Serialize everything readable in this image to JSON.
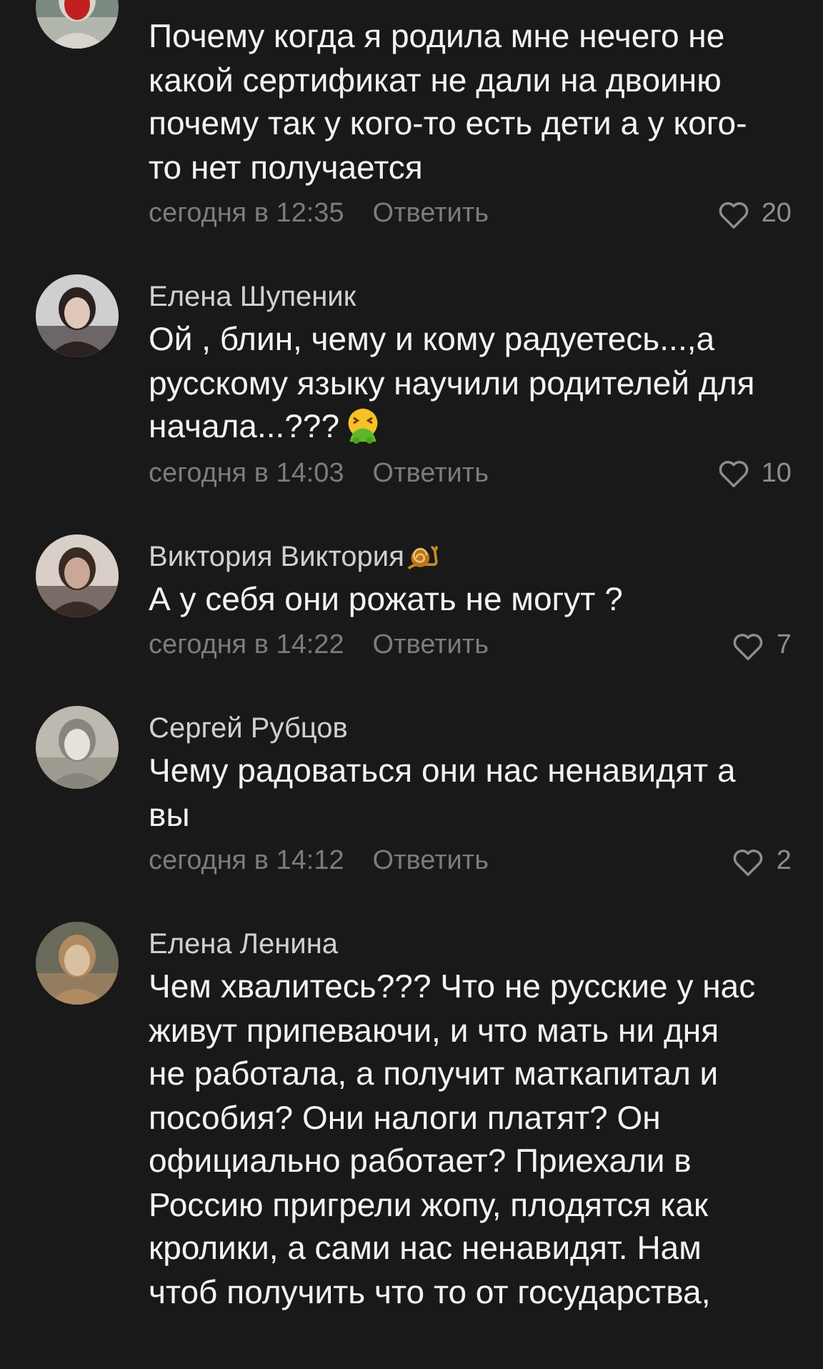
{
  "comments": [
    {
      "text": "Почему когда я родила мне нечего не какой сертификат не дали на двоиню почему так у кого-то есть дети а у кого-то нет получается",
      "time": "сегодня в 12:35",
      "reply": "Ответить",
      "likes": "20"
    },
    {
      "name": "Елена Шупеник",
      "text": "Ой , блин, чему и кому радуетесь...,а русскому языку научили родителей для начала...???",
      "text_emoji": true,
      "time": "сегодня в 14:03",
      "reply": "Ответить",
      "likes": "10"
    },
    {
      "name": "Виктория Виктория",
      "name_emoji": true,
      "text": "А у  себя они рожать не могут ?",
      "time": "сегодня в 14:22",
      "reply": "Ответить",
      "likes": "7"
    },
    {
      "name": "Сергей Рубцов",
      "text": "Чему радоваться  они нас ненавидят а вы",
      "time": "сегодня в 14:12",
      "reply": "Ответить",
      "likes": "2"
    },
    {
      "name": "Елена Ленина",
      "text": "Чем хвалитесь??? Что не русские у нас живут припеваючи, и что мать ни дня не работала, а получит маткапитал и пособия? Они налоги платят? Он официально работает? Приехали в Россию пригрели жопу, плодятся как кролики, а сами нас ненавидят. Нам чтоб получить что то от государства,"
    }
  ]
}
